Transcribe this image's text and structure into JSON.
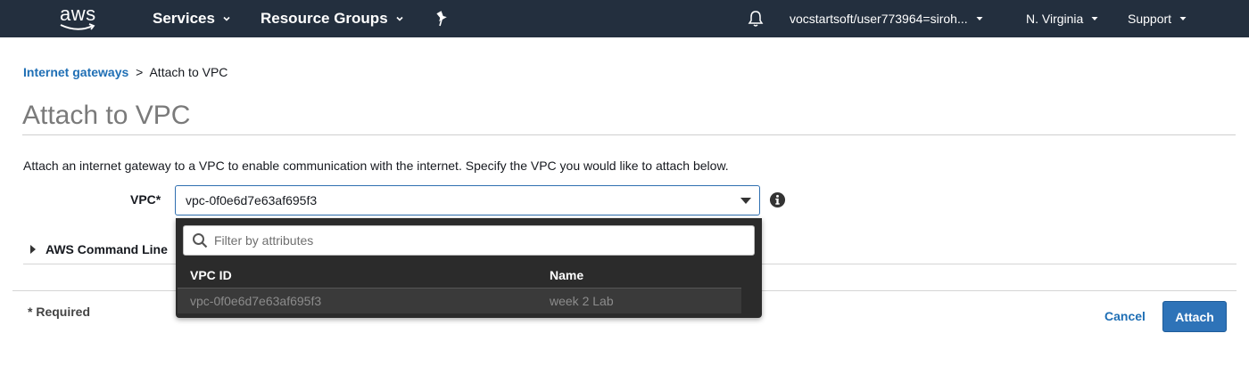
{
  "nav": {
    "logo_text": "aws",
    "services_label": "Services",
    "resource_groups_label": "Resource Groups",
    "account_label": "vocstartsoft/user773964=siroh...",
    "region_label": "N. Virginia",
    "support_label": "Support"
  },
  "breadcrumb": {
    "parent_label": "Internet gateways",
    "separator": ">",
    "current_label": "Attach to VPC"
  },
  "page": {
    "title": "Attach to VPC",
    "description": "Attach an internet gateway to a VPC to enable communication with the internet. Specify the VPC you would like to attach below."
  },
  "form": {
    "vpc_label": "VPC*",
    "vpc_value": "vpc-0f0e6d7e63af695f3",
    "cli_label": "AWS Command Line",
    "required_note": "* Required"
  },
  "dropdown": {
    "filter_placeholder": "Filter by attributes",
    "columns": [
      "VPC ID",
      "Name"
    ],
    "rows": [
      {
        "vpc_id": "vpc-0f0e6d7e63af695f3",
        "name": "week 2 Lab"
      }
    ]
  },
  "actions": {
    "cancel_label": "Cancel",
    "attach_label": "Attach"
  },
  "colors": {
    "nav_bg": "#232f3e",
    "link": "#1f6fb5",
    "primary_button": "#2e73b8",
    "dropdown_bg": "#2b2b2b"
  },
  "icons": [
    "aws-logo-icon",
    "pin-icon",
    "bell-icon",
    "caret-down-icon",
    "dropdown-arrow-icon",
    "info-icon",
    "search-icon",
    "expand-triangle-icon"
  ]
}
